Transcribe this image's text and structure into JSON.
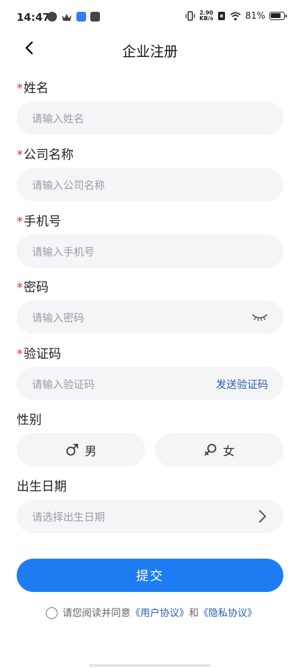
{
  "status_bar": {
    "time": "14:47",
    "net_speed_top": "2.90",
    "net_speed_bottom": "KB/s",
    "battery": "81%"
  },
  "header": {
    "title": "企业注册"
  },
  "form": {
    "name": {
      "label": "姓名",
      "required": "*",
      "placeholder": "请输入姓名"
    },
    "company": {
      "label": "公司名称",
      "required": "*",
      "placeholder": "请输入公司名称"
    },
    "phone": {
      "label": "手机号",
      "required": "*",
      "placeholder": "请输入手机号"
    },
    "password": {
      "label": "密码",
      "required": "*",
      "placeholder": "请输入密码"
    },
    "code": {
      "label": "验证码",
      "required": "*",
      "placeholder": "请输入验证码",
      "send_label": "发送验证码"
    },
    "gender": {
      "label": "性别",
      "male": "男",
      "female": "女"
    },
    "birthday": {
      "label": "出生日期",
      "placeholder": "请选择出生日期"
    }
  },
  "submit_label": "提交",
  "agreement": {
    "prefix": "请您阅读并同意",
    "user_agreement": "《用户协议》",
    "and": "和",
    "privacy_agreement": "《隐私协议》"
  },
  "colors": {
    "primary": "#1e7cf2",
    "link": "#2a5db0",
    "required": "#e53935",
    "field_bg": "#f4f5f7"
  }
}
